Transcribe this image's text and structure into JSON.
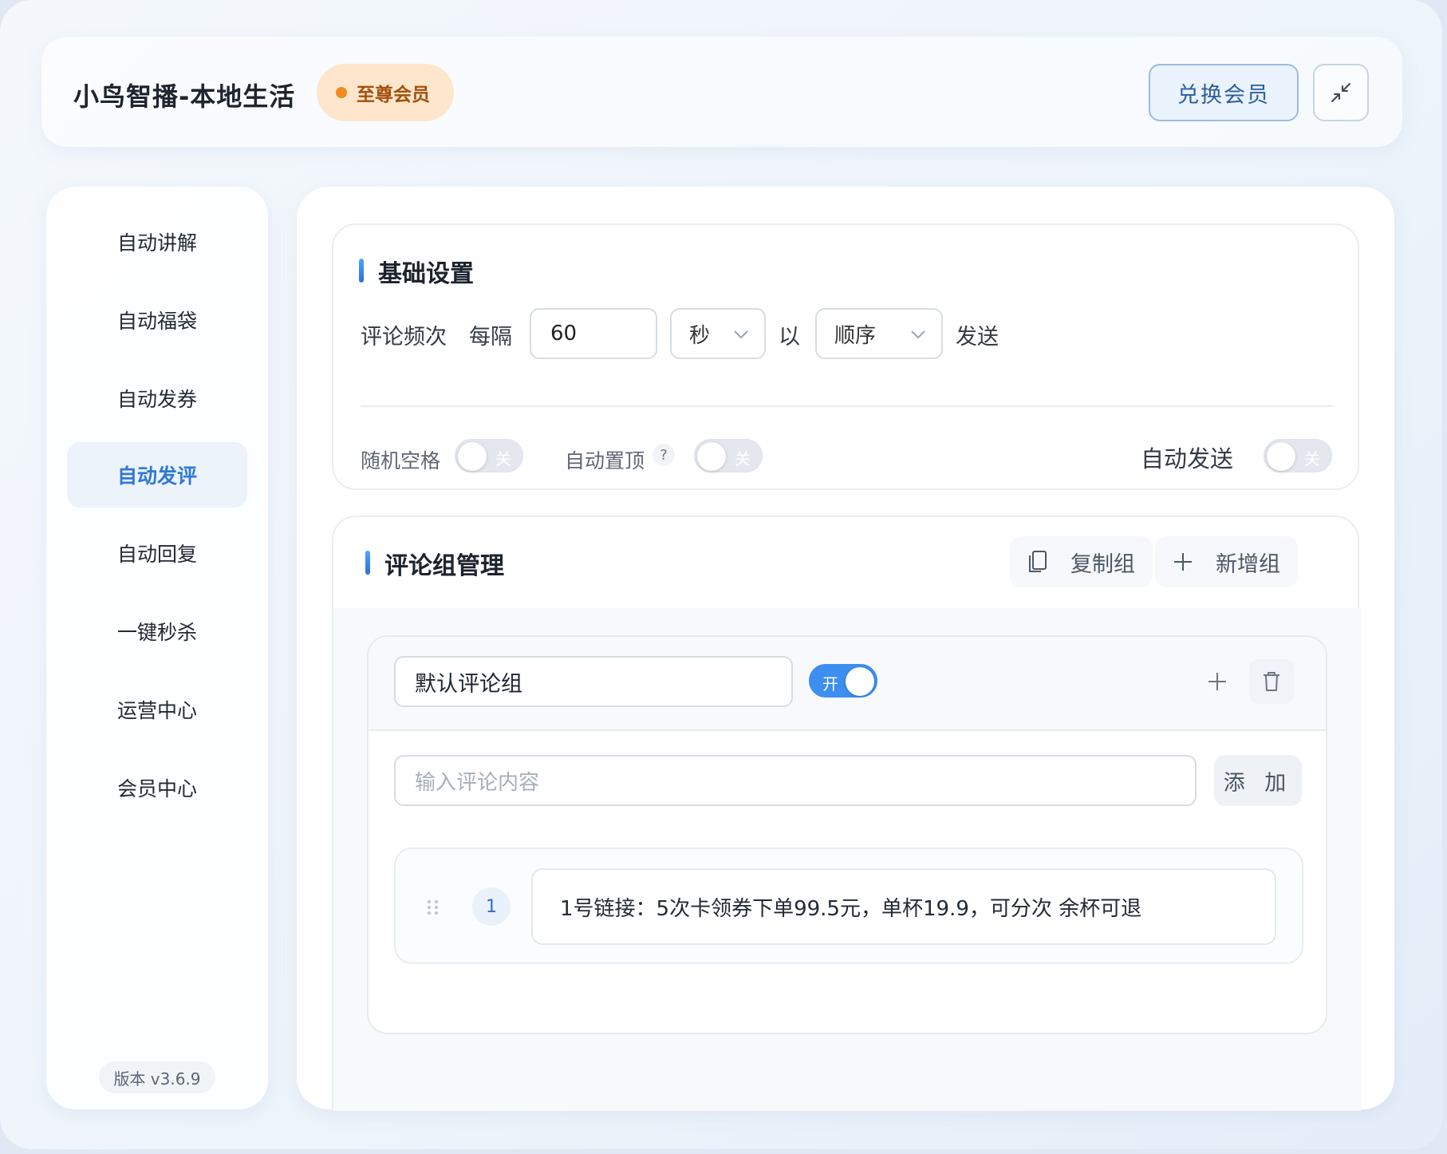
{
  "header": {
    "app_title": "小鸟智播-本地生活",
    "vip_badge": "至尊会员",
    "redeem_label": "兑换会员"
  },
  "sidebar": {
    "items": [
      {
        "label": "自动讲解",
        "active": false
      },
      {
        "label": "自动福袋",
        "active": false
      },
      {
        "label": "自动发券",
        "active": false
      },
      {
        "label": "自动发评",
        "active": true
      },
      {
        "label": "自动回复",
        "active": false
      },
      {
        "label": "一键秒杀",
        "active": false
      },
      {
        "label": "运营中心",
        "active": false
      },
      {
        "label": "会员中心",
        "active": false
      }
    ],
    "version": "版本  v3.6.9"
  },
  "basic_settings": {
    "title": "基础设置",
    "freq_label": "评论频次",
    "every_label": "每隔",
    "interval_value": "60",
    "unit_selected": "秒",
    "by_label": "以",
    "order_selected": "顺序",
    "send_label": "发送",
    "random_space_label": "随机空格",
    "random_space_state": "关",
    "auto_pin_label": "自动置顶",
    "auto_pin_help": "?",
    "auto_pin_state": "关",
    "auto_send_label": "自动发送",
    "auto_send_state": "关"
  },
  "comment_groups": {
    "title": "评论组管理",
    "copy_label": "复制组",
    "add_group_label": "新增组",
    "group": {
      "name": "默认评论组",
      "enabled_state": "开",
      "input_placeholder": "输入评论内容",
      "add_label": "添 加",
      "comments": [
        {
          "index": "1",
          "text": "1号链接：5次卡领券下单99.5元，单杯19.9，可分次 余杯可退"
        }
      ]
    }
  },
  "colors": {
    "accent": "#3c8ef0",
    "active_nav_text": "#2f79d6",
    "vip_bg": "#fde6cc",
    "vip_dot": "#f08c1f"
  }
}
